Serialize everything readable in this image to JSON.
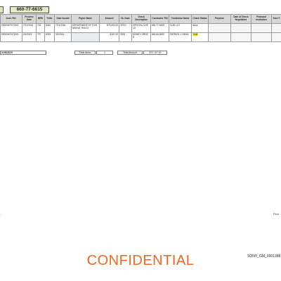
{
  "header": {
    "account_number": "660-77-6615"
  },
  "table": {
    "columns": [
      "Acct. Ref.",
      "Process Date",
      "BRN",
      "Teller",
      "Date Issued",
      "Payee Name",
      "Amount",
      "Ck. Num.",
      "Check Description",
      "Conductor TIN",
      "Conductor Name",
      "Check Status",
      "Purpose",
      "Date of Check Negotiated",
      "Financial Institution",
      "Sour F"
    ],
    "rows": [
      {
        "acct_ref": "00000007072001",
        "process_date": "7/21/2016",
        "brn": "745",
        "teller": "9040",
        "date_issued": "7/21/2016",
        "payee_name": "DEPARTMENT OF TOWNSEND, RISCO",
        "amount": "$70,000.00",
        "ck_num": "33701",
        "check_description": "OFFICIAL CHECK",
        "conductor_tin": "660-77-6615",
        "conductor_name": "CUB, LLC",
        "check_status": "Issue",
        "purpose": "",
        "date_negotiated": "",
        "financial_institution": "",
        "source": ""
      },
      {
        "acct_ref": "00000007072001",
        "process_date": "3/2/2016",
        "brn": "737",
        "teller": "9025",
        "date_issued": "3/2/2016",
        "payee_name": "",
        "amount": "$157.00",
        "ck_num": "3295",
        "check_description": "MONEY ORDER",
        "conductor_tin": "660-60-8000",
        "conductor_name": "PATRICK J. DEAN",
        "check_status": "Void",
        "purpose": "",
        "date_negotiated": "",
        "financial_institution": "",
        "source": ""
      }
    ]
  },
  "summary": {
    "report_date": "2/28/2020",
    "total_items_label": "Total Items",
    "total_items_value": "2",
    "total_amount_label": "Total Amount",
    "total_amount_value": "$70,157.00"
  },
  "footer": {
    "left_marker": "-",
    "right_marker": "First",
    "bates_number": "SONY_GM_0001388",
    "confidential_label": "CONFIDENTIAL"
  },
  "colors": {
    "confidential": "#f2691e",
    "status_highlight": "#f5ea3a",
    "header_fill": "#d7d7d7",
    "account_fill": "#e6e9c4"
  }
}
